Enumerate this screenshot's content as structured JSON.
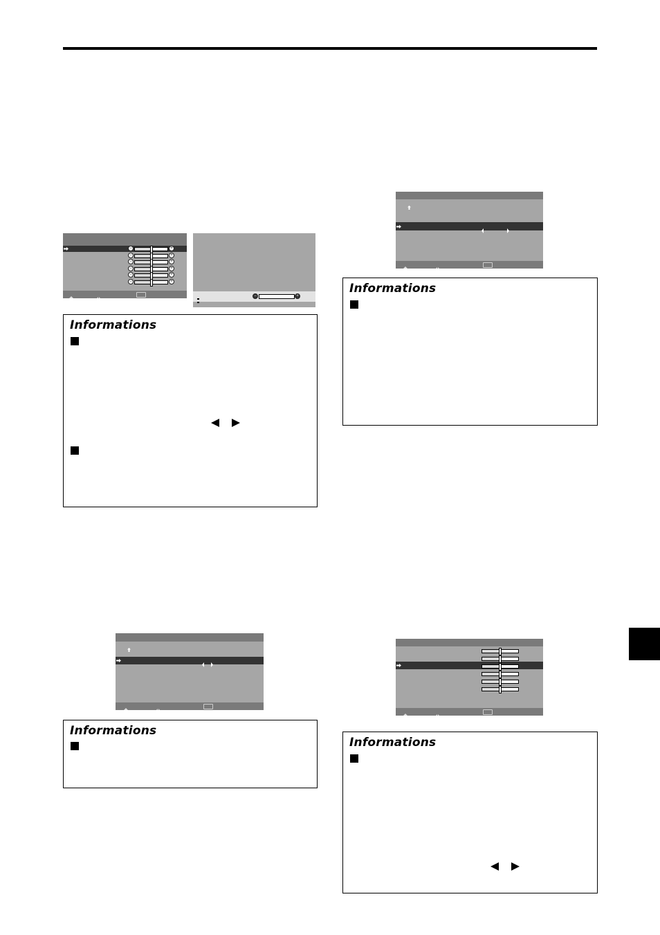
{
  "page": {
    "side_tab_label": ""
  },
  "osd_menus": [
    {
      "id": "picture-adjust-menu",
      "rows": 6,
      "selected_row": 1,
      "sliders": [
        {
          "value_fraction": 0.5
        },
        {
          "value_fraction": 0.5
        },
        {
          "value_fraction": 0.5
        },
        {
          "value_fraction": 0.5
        },
        {
          "value_fraction": 0.5
        },
        {
          "value_fraction": 0.5
        }
      ],
      "footer_icons": [
        "up-down-select-icon",
        "left-right-adjust-icon",
        "exit-button-icon"
      ]
    },
    {
      "id": "single-adjust-bar",
      "slider": {
        "value_fraction": 1.0
      },
      "footer_icons": [
        "up-down-select-icon"
      ]
    },
    {
      "id": "option-menu-top-right",
      "selected_row": 3,
      "footer_icons": [
        "up-down-select-icon",
        "left-right-adjust-icon",
        "exit-button-icon"
      ]
    },
    {
      "id": "option-menu-bottom-left",
      "selected_row": 3,
      "footer_icons": [
        "up-down-select-icon",
        "left-right-adjust-icon",
        "exit-button-icon"
      ]
    },
    {
      "id": "slider-menu-bottom-right",
      "selected_row": 3,
      "sliders": [
        {
          "value_fraction": 0.5
        },
        {
          "value_fraction": 0.5
        },
        {
          "value_fraction": 0.5
        },
        {
          "value_fraction": 0.5
        },
        {
          "value_fraction": 0.5
        },
        {
          "value_fraction": 0.5
        }
      ],
      "footer_icons": [
        "up-down-select-icon",
        "left-right-adjust-icon",
        "exit-button-icon"
      ]
    }
  ],
  "info_boxes": [
    {
      "heading": "Informations",
      "bullets": 2,
      "has_arrow_keys": true
    },
    {
      "heading": "Informations",
      "bullets": 1,
      "has_arrow_keys": false
    },
    {
      "heading": "Informations",
      "bullets": 1,
      "has_arrow_keys": false
    },
    {
      "heading": "Informations",
      "bullets": 1,
      "has_arrow_keys": true
    }
  ]
}
